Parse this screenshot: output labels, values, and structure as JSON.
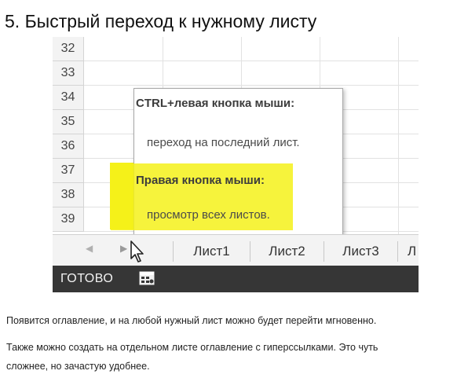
{
  "title": "5. Быстрый переход к нужному листу",
  "excel": {
    "rows": [
      "32",
      "33",
      "34",
      "35",
      "36",
      "37",
      "38",
      "39"
    ],
    "tooltip": {
      "section1_header": "CTRL+левая кнопка мыши:",
      "section1_text": "переход на последний лист.",
      "section2_header": "Правая кнопка мыши:",
      "section2_text": "просмотр всех листов.",
      "highlight_color": "#f5f11a"
    },
    "tabs": {
      "nav_prev_icon": "triangle-left-icon",
      "nav_next_icon": "triangle-right-icon",
      "sheets": [
        "Лист1",
        "Лист2",
        "Лист3"
      ],
      "partial_sheet_glyph": "Л"
    },
    "status": {
      "label": "ГОТОВО",
      "icon": "macro-sheet-icon",
      "bar_color": "#363636"
    }
  },
  "paragraph1": "Появится оглавление, и на любой нужный лист можно будет перейти мгновенно.",
  "paragraph2_line1": "Также можно создать на отдельном листе оглавление с гиперссылками. Это чуть",
  "paragraph2_line2": "сложнее, но зачастую удобнее."
}
